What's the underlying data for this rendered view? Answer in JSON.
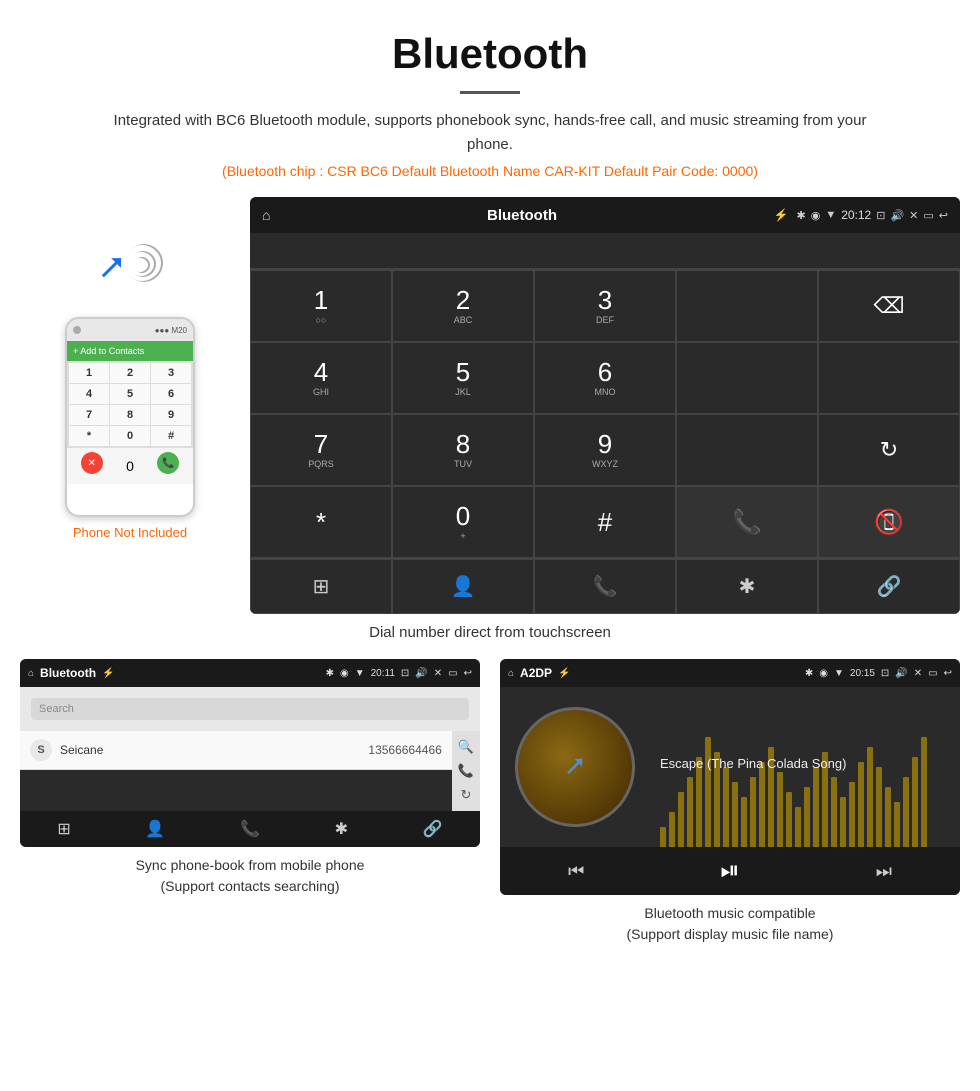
{
  "page": {
    "title": "Bluetooth",
    "subtitle": "Integrated with BC6 Bluetooth module, supports phonebook sync, hands-free call, and music streaming from your phone.",
    "orange_info": "(Bluetooth chip : CSR BC6    Default Bluetooth Name CAR-KIT    Default Pair Code: 0000)",
    "phone_not_included": "Phone Not Included",
    "dial_caption": "Dial number direct from touchscreen",
    "phonebook_caption": "Sync phone-book from mobile phone\n(Support contacts searching)",
    "music_caption": "Bluetooth music compatible\n(Support display music file name)"
  },
  "car_screen": {
    "status_bar": {
      "home_icon": "⌂",
      "title": "Bluetooth",
      "usb_icon": "⚡",
      "bt_icon": "✱",
      "location_icon": "◉",
      "signal_icon": "▼",
      "time": "20:12",
      "camera_icon": "📷",
      "volume_icon": "🔊",
      "close_icon": "✕",
      "window_icon": "▭",
      "back_icon": "↩"
    },
    "dialpad": {
      "keys": [
        {
          "main": "1",
          "sub": "○○"
        },
        {
          "main": "2",
          "sub": "ABC"
        },
        {
          "main": "3",
          "sub": "DEF"
        },
        {
          "main": "",
          "sub": ""
        },
        {
          "main": "⌫",
          "sub": ""
        },
        {
          "main": "4",
          "sub": "GHI"
        },
        {
          "main": "5",
          "sub": "JKL"
        },
        {
          "main": "6",
          "sub": "MNO"
        },
        {
          "main": "",
          "sub": ""
        },
        {
          "main": "",
          "sub": ""
        },
        {
          "main": "7",
          "sub": "PQRS"
        },
        {
          "main": "8",
          "sub": "TUV"
        },
        {
          "main": "9",
          "sub": "WXYZ"
        },
        {
          "main": "",
          "sub": ""
        },
        {
          "main": "↻",
          "sub": ""
        },
        {
          "main": "*",
          "sub": ""
        },
        {
          "main": "0",
          "sub": "+"
        },
        {
          "main": "#",
          "sub": ""
        },
        {
          "main": "📞",
          "sub": ""
        },
        {
          "main": "📵",
          "sub": ""
        }
      ],
      "bottom_icons": [
        "⊞",
        "👤",
        "📞",
        "✱",
        "🔗"
      ]
    }
  },
  "phonebook_screen": {
    "status_bar": {
      "home_icon": "⌂",
      "title": "Bluetooth",
      "usb_icon": "⚡",
      "bt_icon": "✱",
      "time": "20:11",
      "camera_icon": "📷",
      "volume_icon": "🔊",
      "back_icon": "↩"
    },
    "search_placeholder": "Search",
    "contacts": [
      {
        "letter": "S",
        "name": "Seicane",
        "number": "13566664466"
      }
    ],
    "side_icons": [
      "🔍",
      "📞",
      "↻"
    ],
    "bottom_icons": [
      "⊞",
      "👤",
      "📞",
      "✱",
      "🔗"
    ]
  },
  "music_screen": {
    "status_bar": {
      "home_icon": "⌂",
      "title": "A2DP",
      "usb_icon": "⚡",
      "bt_icon": "✱",
      "time": "20:15",
      "camera_icon": "📷",
      "volume_icon": "🔊",
      "back_icon": "↩"
    },
    "song_title": "Escape (The Pina Colada Song)",
    "controls": {
      "prev": "⏮",
      "play_pause": "⏯",
      "next": "⏭"
    },
    "eq_bars": [
      20,
      35,
      55,
      70,
      90,
      110,
      95,
      80,
      65,
      50,
      70,
      85,
      100,
      75,
      55,
      40,
      60,
      80,
      95,
      70,
      50,
      65,
      85,
      100,
      80,
      60,
      45,
      70,
      90,
      110
    ]
  },
  "phone_mockup": {
    "add_contacts_label": "+ Add to Contacts",
    "dial_keys": [
      "1",
      "2",
      "3",
      "4",
      "5",
      "6",
      "7",
      "8",
      "9",
      "*",
      "0",
      "#"
    ]
  }
}
